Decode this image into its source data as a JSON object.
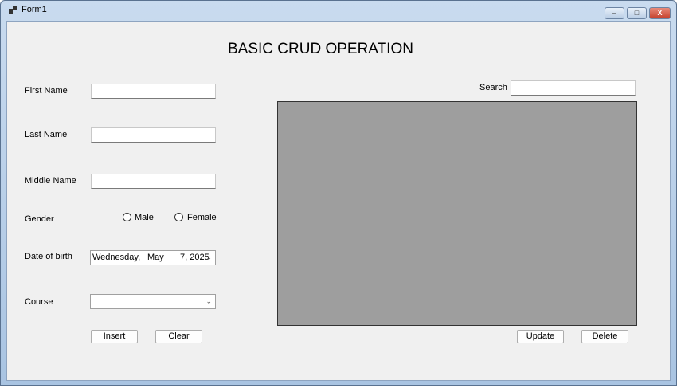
{
  "window": {
    "title": "Form1",
    "minimize": "–",
    "maximize": "□",
    "close": "X"
  },
  "heading": "BASIC CRUD OPERATION",
  "form": {
    "first_name": {
      "label": "First Name",
      "value": ""
    },
    "last_name": {
      "label": "Last Name",
      "value": ""
    },
    "middle_name": {
      "label": "Middle Name",
      "value": ""
    },
    "gender": {
      "label": "Gender",
      "options": [
        "Male",
        "Female"
      ]
    },
    "dob": {
      "label": "Date of birth",
      "weekday": "Wednesday,",
      "month": "May",
      "day_year": "7, 2025"
    },
    "course": {
      "label": "Course",
      "value": ""
    },
    "insert": "Insert",
    "clear": "Clear"
  },
  "search": {
    "label": "Search",
    "value": ""
  },
  "grid": {
    "color": "#9e9e9e"
  },
  "update": "Update",
  "delete": "Delete"
}
